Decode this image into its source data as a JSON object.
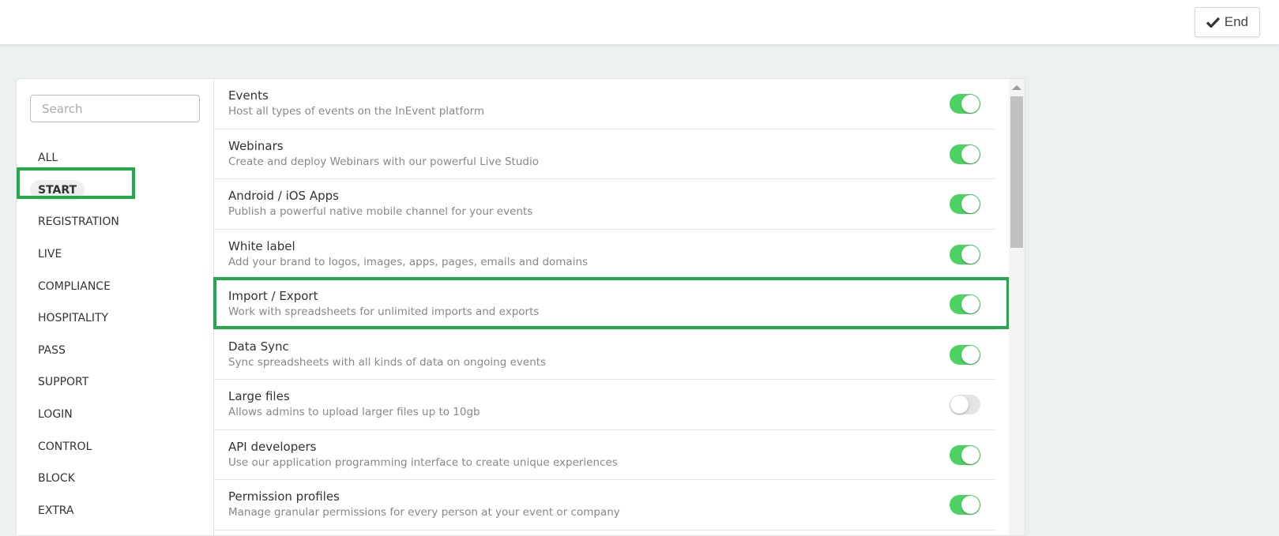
{
  "header": {
    "end_label": "End",
    "end_icon": "check-icon"
  },
  "sidebar": {
    "search_placeholder": "Search",
    "items": [
      {
        "label": "ALL"
      },
      {
        "label": "START",
        "active": true
      },
      {
        "label": "REGISTRATION"
      },
      {
        "label": "LIVE"
      },
      {
        "label": "COMPLIANCE"
      },
      {
        "label": "HOSPITALITY"
      },
      {
        "label": "PASS"
      },
      {
        "label": "SUPPORT"
      },
      {
        "label": "LOGIN"
      },
      {
        "label": "CONTROL"
      },
      {
        "label": "BLOCK"
      },
      {
        "label": "EXTRA"
      }
    ]
  },
  "features": [
    {
      "title": "Events",
      "desc": "Host all types of events on the InEvent platform",
      "enabled": true
    },
    {
      "title": "Webinars",
      "desc": "Create and deploy Webinars with our powerful Live Studio",
      "enabled": true
    },
    {
      "title": "Android / iOS Apps",
      "desc": "Publish a powerful native mobile channel for your events",
      "enabled": true
    },
    {
      "title": "White label",
      "desc": "Add your brand to logos, images, apps, pages, emails and domains",
      "enabled": true
    },
    {
      "title": "Import / Export",
      "desc": "Work with spreadsheets for unlimited imports and exports",
      "enabled": true
    },
    {
      "title": "Data Sync",
      "desc": "Sync spreadsheets with all kinds of data on ongoing events",
      "enabled": true
    },
    {
      "title": "Large files",
      "desc": "Allows admins to upload larger files up to 10gb",
      "enabled": false
    },
    {
      "title": "API developers",
      "desc": "Use our application programming interface to create unique experiences",
      "enabled": true
    },
    {
      "title": "Permission profiles",
      "desc": "Manage granular permissions for every person at your event or company",
      "enabled": true
    }
  ],
  "colors": {
    "toggle_on": "#4cd263",
    "highlight": "#22aa4a"
  }
}
